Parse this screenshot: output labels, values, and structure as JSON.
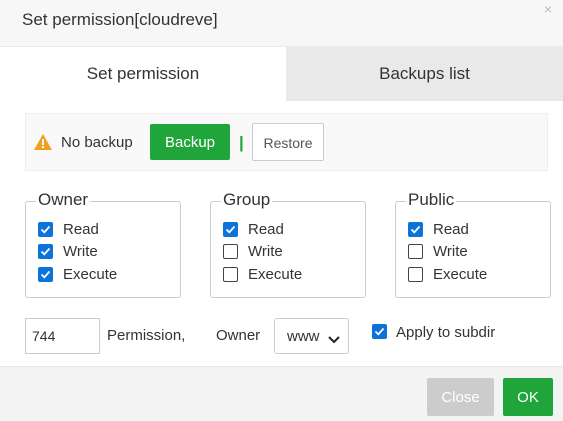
{
  "dialog": {
    "title": "Set permission[cloudreve]",
    "close_glyph": "×"
  },
  "tabs": [
    {
      "label": "Set permission",
      "active": true
    },
    {
      "label": "Backups list",
      "active": false
    }
  ],
  "backup_bar": {
    "icon": "warning-icon",
    "status": "No backup",
    "backup_label": "Backup",
    "separator": "|",
    "restore_label": "Restore"
  },
  "groups": [
    {
      "legend": "Owner",
      "perms": [
        {
          "label": "Read",
          "checked": true
        },
        {
          "label": "Write",
          "checked": true
        },
        {
          "label": "Execute",
          "checked": true
        }
      ]
    },
    {
      "legend": "Group",
      "perms": [
        {
          "label": "Read",
          "checked": true
        },
        {
          "label": "Write",
          "checked": false
        },
        {
          "label": "Execute",
          "checked": false
        }
      ]
    },
    {
      "legend": "Public",
      "perms": [
        {
          "label": "Read",
          "checked": true
        },
        {
          "label": "Write",
          "checked": false
        },
        {
          "label": "Execute",
          "checked": false
        }
      ]
    }
  ],
  "settings": {
    "permission_value": "744",
    "permission_label": "Permission,",
    "owner_label": "Owner",
    "owner_selected": "www",
    "apply_subdir_label": "Apply to subdir",
    "apply_subdir_checked": true
  },
  "footer": {
    "close_label": "Close",
    "ok_label": "OK"
  },
  "colors": {
    "accent_green": "#20a53a",
    "checkbox_blue": "#0b73d9",
    "warning_orange": "#f0a020",
    "disabled_gray": "#cccccc"
  }
}
